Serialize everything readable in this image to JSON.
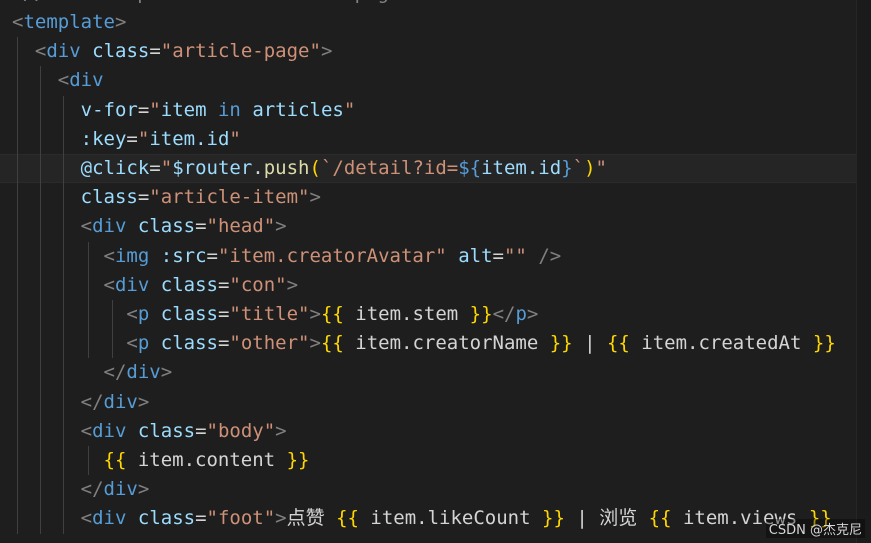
{
  "code": {
    "top_fragment": "  // ...  import  ...  article-page  ...",
    "lines": [
      [
        [
          "<",
          "t-tag"
        ],
        [
          "template",
          "t-name"
        ],
        [
          ">",
          "t-tag"
        ]
      ],
      [
        [
          "  ",
          "t-txt"
        ],
        [
          "<",
          "t-tag"
        ],
        [
          "div",
          "t-name"
        ],
        [
          " ",
          "t-txt"
        ],
        [
          "class",
          "t-attr"
        ],
        [
          "=",
          "t-op"
        ],
        [
          "\"article-page\"",
          "t-str"
        ],
        [
          ">",
          "t-tag"
        ]
      ],
      [
        [
          "    ",
          "t-txt"
        ],
        [
          "<",
          "t-tag"
        ],
        [
          "div",
          "t-name"
        ]
      ],
      [
        [
          "      ",
          "t-txt"
        ],
        [
          "v-for",
          "t-attr"
        ],
        [
          "=",
          "t-op"
        ],
        [
          "\"",
          "t-str"
        ],
        [
          "item",
          "t-attr"
        ],
        [
          " ",
          "t-txt"
        ],
        [
          "in",
          "t-kw"
        ],
        [
          " ",
          "t-txt"
        ],
        [
          "articles",
          "t-attr"
        ],
        [
          "\"",
          "t-str"
        ]
      ],
      [
        [
          "      ",
          "t-txt"
        ],
        [
          ":key",
          "t-attr"
        ],
        [
          "=",
          "t-op"
        ],
        [
          "\"",
          "t-str"
        ],
        [
          "item.id",
          "t-attr"
        ],
        [
          "\"",
          "t-str"
        ]
      ],
      [
        [
          "      ",
          "t-txt"
        ],
        [
          "@click",
          "t-attr"
        ],
        [
          "=",
          "t-op"
        ],
        [
          "\"",
          "t-str"
        ],
        [
          "$router",
          "t-attr"
        ],
        [
          ".",
          "t-op"
        ],
        [
          "push",
          "t-fn"
        ],
        [
          "(",
          "t-brace"
        ],
        [
          "`/detail?id=",
          "t-str"
        ],
        [
          "${",
          "t-kw"
        ],
        [
          "item.id",
          "t-attr"
        ],
        [
          "}",
          "t-kw"
        ],
        [
          "`",
          "t-str"
        ],
        [
          ")",
          "t-brace"
        ],
        [
          "\"",
          "t-str"
        ]
      ],
      [
        [
          "      ",
          "t-txt"
        ],
        [
          "class",
          "t-attr"
        ],
        [
          "=",
          "t-op"
        ],
        [
          "\"article-item\"",
          "t-str"
        ],
        [
          ">",
          "t-tag"
        ]
      ],
      [
        [
          "      ",
          "t-txt"
        ],
        [
          "<",
          "t-tag"
        ],
        [
          "div",
          "t-name"
        ],
        [
          " ",
          "t-txt"
        ],
        [
          "class",
          "t-attr"
        ],
        [
          "=",
          "t-op"
        ],
        [
          "\"head\"",
          "t-str"
        ],
        [
          ">",
          "t-tag"
        ]
      ],
      [
        [
          "        ",
          "t-txt"
        ],
        [
          "<",
          "t-tag"
        ],
        [
          "img",
          "t-name"
        ],
        [
          " ",
          "t-txt"
        ],
        [
          ":src",
          "t-attr"
        ],
        [
          "=",
          "t-op"
        ],
        [
          "\"item.creatorAvatar\"",
          "t-str"
        ],
        [
          " ",
          "t-txt"
        ],
        [
          "alt",
          "t-attr"
        ],
        [
          "=",
          "t-op"
        ],
        [
          "\"\"",
          "t-str"
        ],
        [
          " ",
          "t-txt"
        ],
        [
          "/>",
          "t-tag"
        ]
      ],
      [
        [
          "        ",
          "t-txt"
        ],
        [
          "<",
          "t-tag"
        ],
        [
          "div",
          "t-name"
        ],
        [
          " ",
          "t-txt"
        ],
        [
          "class",
          "t-attr"
        ],
        [
          "=",
          "t-op"
        ],
        [
          "\"con\"",
          "t-str"
        ],
        [
          ">",
          "t-tag"
        ]
      ],
      [
        [
          "          ",
          "t-txt"
        ],
        [
          "<",
          "t-tag"
        ],
        [
          "p",
          "t-name"
        ],
        [
          " ",
          "t-txt"
        ],
        [
          "class",
          "t-attr"
        ],
        [
          "=",
          "t-op"
        ],
        [
          "\"title\"",
          "t-str"
        ],
        [
          ">",
          "t-tag"
        ],
        [
          "{{",
          "t-brace"
        ],
        [
          " item.stem ",
          "t-txt"
        ],
        [
          "}}",
          "t-brace"
        ],
        [
          "</",
          "t-tag"
        ],
        [
          "p",
          "t-name"
        ],
        [
          ">",
          "t-tag"
        ]
      ],
      [
        [
          "          ",
          "t-txt"
        ],
        [
          "<",
          "t-tag"
        ],
        [
          "p",
          "t-name"
        ],
        [
          " ",
          "t-txt"
        ],
        [
          "class",
          "t-attr"
        ],
        [
          "=",
          "t-op"
        ],
        [
          "\"other\"",
          "t-str"
        ],
        [
          ">",
          "t-tag"
        ],
        [
          "{{",
          "t-brace"
        ],
        [
          " item.creatorName ",
          "t-txt"
        ],
        [
          "}}",
          "t-brace"
        ],
        [
          " | ",
          "t-txt"
        ],
        [
          "{{",
          "t-brace"
        ],
        [
          " item.createdAt ",
          "t-txt"
        ],
        [
          "}}",
          "t-brace"
        ]
      ],
      [
        [
          "        ",
          "t-txt"
        ],
        [
          "</",
          "t-tag"
        ],
        [
          "div",
          "t-name"
        ],
        [
          ">",
          "t-tag"
        ]
      ],
      [
        [
          "      ",
          "t-txt"
        ],
        [
          "</",
          "t-tag"
        ],
        [
          "div",
          "t-name"
        ],
        [
          ">",
          "t-tag"
        ]
      ],
      [
        [
          "      ",
          "t-txt"
        ],
        [
          "<",
          "t-tag"
        ],
        [
          "div",
          "t-name"
        ],
        [
          " ",
          "t-txt"
        ],
        [
          "class",
          "t-attr"
        ],
        [
          "=",
          "t-op"
        ],
        [
          "\"body\"",
          "t-str"
        ],
        [
          ">",
          "t-tag"
        ]
      ],
      [
        [
          "        ",
          "t-txt"
        ],
        [
          "{{",
          "t-brace"
        ],
        [
          " item.content ",
          "t-txt"
        ],
        [
          "}}",
          "t-brace"
        ]
      ],
      [
        [
          "      ",
          "t-txt"
        ],
        [
          "</",
          "t-tag"
        ],
        [
          "div",
          "t-name"
        ],
        [
          ">",
          "t-tag"
        ]
      ],
      [
        [
          "      ",
          "t-txt"
        ],
        [
          "<",
          "t-tag"
        ],
        [
          "div",
          "t-name"
        ],
        [
          " ",
          "t-txt"
        ],
        [
          "class",
          "t-attr"
        ],
        [
          "=",
          "t-op"
        ],
        [
          "\"foot\"",
          "t-str"
        ],
        [
          ">",
          "t-tag"
        ],
        [
          "点赞 ",
          "t-txt"
        ],
        [
          "{{",
          "t-brace"
        ],
        [
          " item.likeCount ",
          "t-txt"
        ],
        [
          "}}",
          "t-brace"
        ],
        [
          " | 浏览 ",
          "t-txt"
        ],
        [
          "{{",
          "t-brace"
        ],
        [
          " item.views ",
          "t-txt"
        ],
        [
          "}}",
          "t-brace"
        ]
      ]
    ],
    "highlighted_line": 5
  },
  "watermark": "CSDN @杰克尼"
}
